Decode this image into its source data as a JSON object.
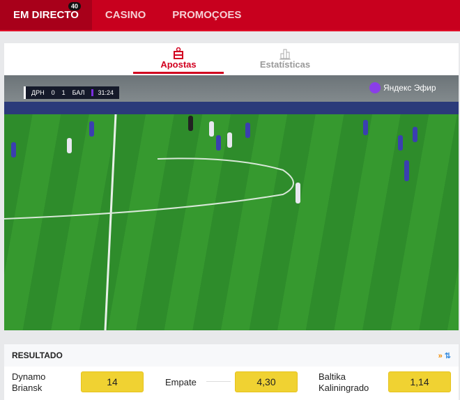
{
  "nav": {
    "items": [
      {
        "label": "EM DIRECTO",
        "badge": "40"
      },
      {
        "label": "CASINO"
      },
      {
        "label": "PROMOÇOES"
      }
    ]
  },
  "tabs": [
    {
      "label": "Apostas",
      "icon": "ticket-icon"
    },
    {
      "label": "Estatísticas",
      "icon": "bar-chart-icon"
    }
  ],
  "video": {
    "scoreboard": {
      "home": "ДРН",
      "home_score": "0",
      "away_score": "1",
      "away": "БАЛ",
      "clock": "31:24"
    },
    "watermark": "Яндекс Эфир"
  },
  "result": {
    "title": "RESULTADO",
    "outcomes": [
      {
        "label": "Dynamo Briansk",
        "odd": "14"
      },
      {
        "label": "Empate",
        "odd": "4,30"
      },
      {
        "label": "Baltika Kaliningrado",
        "odd": "1,14"
      }
    ]
  },
  "colors": {
    "brand": "#c8001e",
    "odd_bg": "#f0d232"
  }
}
